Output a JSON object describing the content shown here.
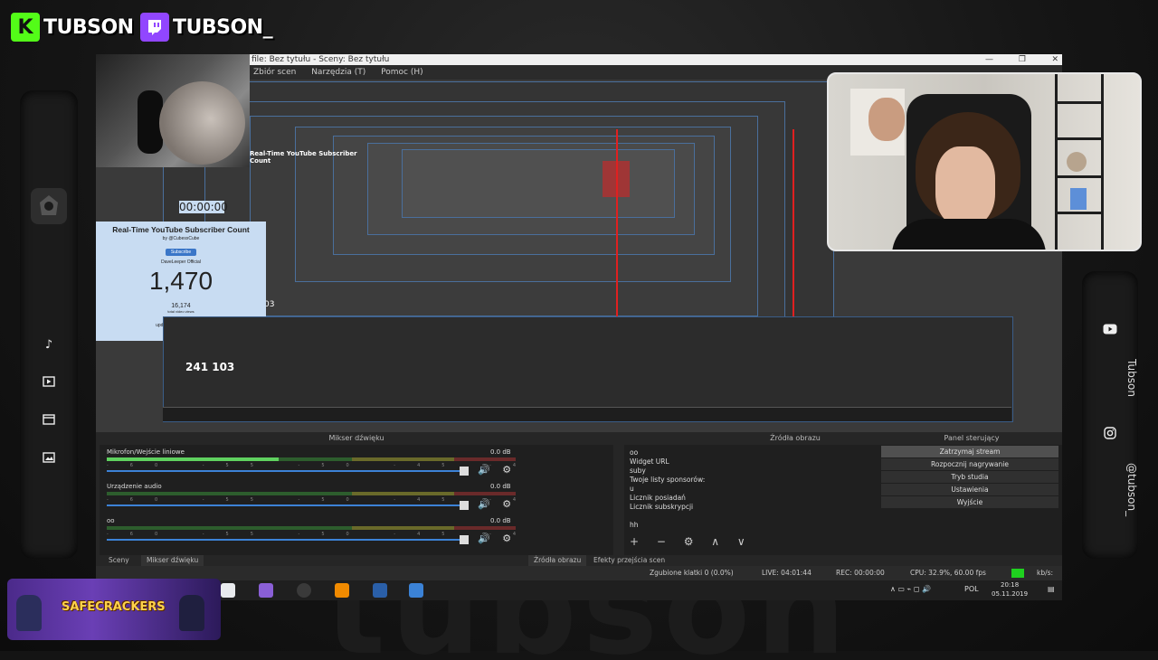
{
  "brand": {
    "kick_logo": "K",
    "kick_name": "TUBSON",
    "twitch_name": "TUBSON_",
    "kick_color": "#53fc18",
    "twitch_color": "#9146ff"
  },
  "background_wordmark": "tubson",
  "rail_left": {
    "icons": [
      "music-icon",
      "video-icon",
      "calendar-icon",
      "image-icon"
    ]
  },
  "rail_right": {
    "youtube_label": "Tubson",
    "instagram_label": "@tubson_"
  },
  "obs": {
    "title": "file: Bez tytułu - Sceny: Bez tytułu",
    "menu": [
      "Zbiór scen",
      "Narzędzia (T)",
      "Pomoc (H)"
    ],
    "inner_counter": "241 103",
    "inner_counter_small": "03",
    "mixer": {
      "header": "Mikser dźwięku",
      "channels": [
        {
          "label": "Mikrofon/Wejście liniowe",
          "db": "0.0 dB",
          "level": 0.42
        },
        {
          "label": "Urządzenie audio",
          "db": "0.0 dB",
          "level": 0.0
        },
        {
          "label": "oo",
          "db": "0.0 dB",
          "level": 0.0
        }
      ],
      "scale": "-60 -55 -50 -45 -40 -35 -30 -25 -20 -15 -10 -5 0"
    },
    "sources": {
      "header": "Źródła obrazu",
      "items": [
        "oo",
        "Widget URL",
        "suby",
        "Twoje listy sponsorów:",
        "u",
        "Licznik posiadań",
        "Licznik subskrypcji",
        "",
        "hh"
      ],
      "toolbar": "+ − ⚙ ∧ ∨"
    },
    "controls": {
      "header": "Panel sterujący",
      "buttons": [
        "Zatrzymaj stream",
        "Rozpocznij nagrywanie",
        "Tryb studia",
        "Ustawienia",
        "Wyjście"
      ]
    },
    "tabs_left": [
      "Sceny",
      "Mikser dźwięku"
    ],
    "tabs_right": [
      "Źródła obrazu",
      "Efekty przejścia scen"
    ],
    "status": {
      "dropped": "Zgubione klatki 0 (0.0%)",
      "live": "LIVE: 04:01:44",
      "rec": "REC: 00:00:00",
      "cpu": "CPU: 32.9%, 60.00 fps",
      "kbs": "kb/s:"
    }
  },
  "sub_widget": {
    "title": "Real-Time YouTube Subscriber Count",
    "by": "by @CubesxCube",
    "button": "Subscribe",
    "channel": "DaveLeeper Official",
    "count": "1,470",
    "views": "16,174",
    "views_label": "total video views",
    "updated": "updated every 2 seconds",
    "mirror_title": "Real-Time YouTube Subscriber Count",
    "mirror_timer": "00:00:00"
  },
  "taskbar": {
    "lang": "POL",
    "time": "20:18",
    "date": "05.11.2019"
  },
  "banner": {
    "title": "SAFECRACKERS"
  }
}
